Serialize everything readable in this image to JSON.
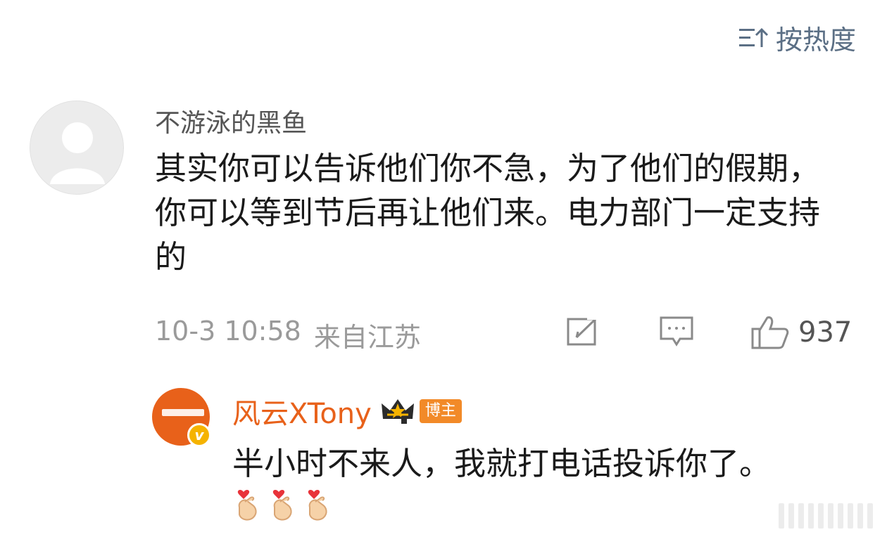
{
  "sort": {
    "label": "按热度",
    "icon": "sort-icon"
  },
  "comment": {
    "avatar_icon": "default-avatar-icon",
    "username": "不游泳的黑鱼",
    "text": "其实你可以告诉他们你不急，为了他们的假期，你可以等到节后再让他们来。电力部门一定支持的",
    "time": "10-3 10:58",
    "location": "来自江苏",
    "actions": {
      "repost_icon": "repost-icon",
      "comment_icon": "comment-icon",
      "like_icon": "like-icon",
      "like_count": "937"
    }
  },
  "reply": {
    "avatar_icon": "user-avatar",
    "verified_icon": "verified-v-icon",
    "username": "风云XTony",
    "crown_icon": "crown-icon",
    "badge": "博主",
    "text": "半小时不来人，我就打电话投诉你了。",
    "emojis": [
      "finger-heart-emoji",
      "finger-heart-emoji",
      "finger-heart-emoji"
    ]
  },
  "colors": {
    "link": "#e8611a",
    "muted": "#9a9a9a",
    "sort": "#5b6f85",
    "badge": "#f28a28"
  }
}
